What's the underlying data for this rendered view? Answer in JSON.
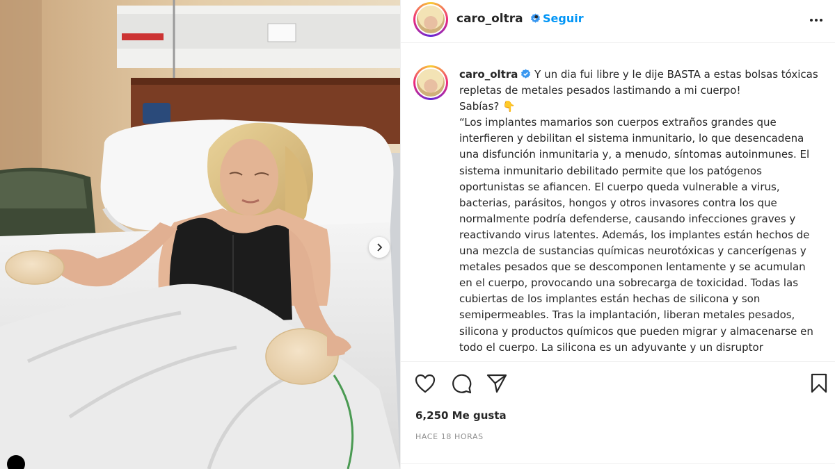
{
  "post": {
    "username": "caro_oltra",
    "follow_label": "Seguir",
    "separator": "•",
    "caption_lines": [
      "Y un dia fui libre y le dije BASTA a estas bolsas tóxicas",
      "repletas de metales pesados lastimando a mi cuerpo!",
      "Sabías? 👇",
      "“Los implantes mamarios son cuerpos extraños grandes que",
      "interfieren y debilitan el sistema inmunitario, lo que desencadena",
      "una disfunción inmunitaria y, a menudo, síntomas autoinmunes. El",
      "sistema inmunitario debilitado permite que los patógenos",
      "oportunistas se afiancen. El cuerpo queda vulnerable a virus,",
      "bacterias, parásitos, hongos y otros invasores contra los que",
      "normalmente podría defenderse, causando infecciones graves y",
      "reactivando virus latentes. Además, los implantes están hechos de",
      "una mezcla de sustancias químicas neurotóxicas y cancerígenas y",
      "metales pesados que se descomponen lentamente y se acumulan",
      "en el cuerpo, provocando una sobrecarga de toxicidad. Todas las",
      "cubiertas de los implantes están hechas de silicona y son",
      "semipermeables. Tras la implantación, liberan metales pesados,",
      "silicona y productos químicos que pueden migrar y almacenarse en",
      "todo el cuerpo. La silicona es un adyuvante y un disruptor"
    ],
    "likes": "6,250 Me gusta",
    "time": "HACE 18 HORAS"
  },
  "colors": {
    "accent": "#0095f6",
    "verified": "#3897f0",
    "text": "#262626",
    "muted": "#8e8e8e"
  },
  "icons": {
    "more": "more-horizontal-icon",
    "verified": "verified-badge-icon",
    "like": "heart-icon",
    "comment": "comment-bubble-icon",
    "share": "paper-plane-icon",
    "save": "bookmark-icon",
    "next": "chevron-right-icon"
  }
}
